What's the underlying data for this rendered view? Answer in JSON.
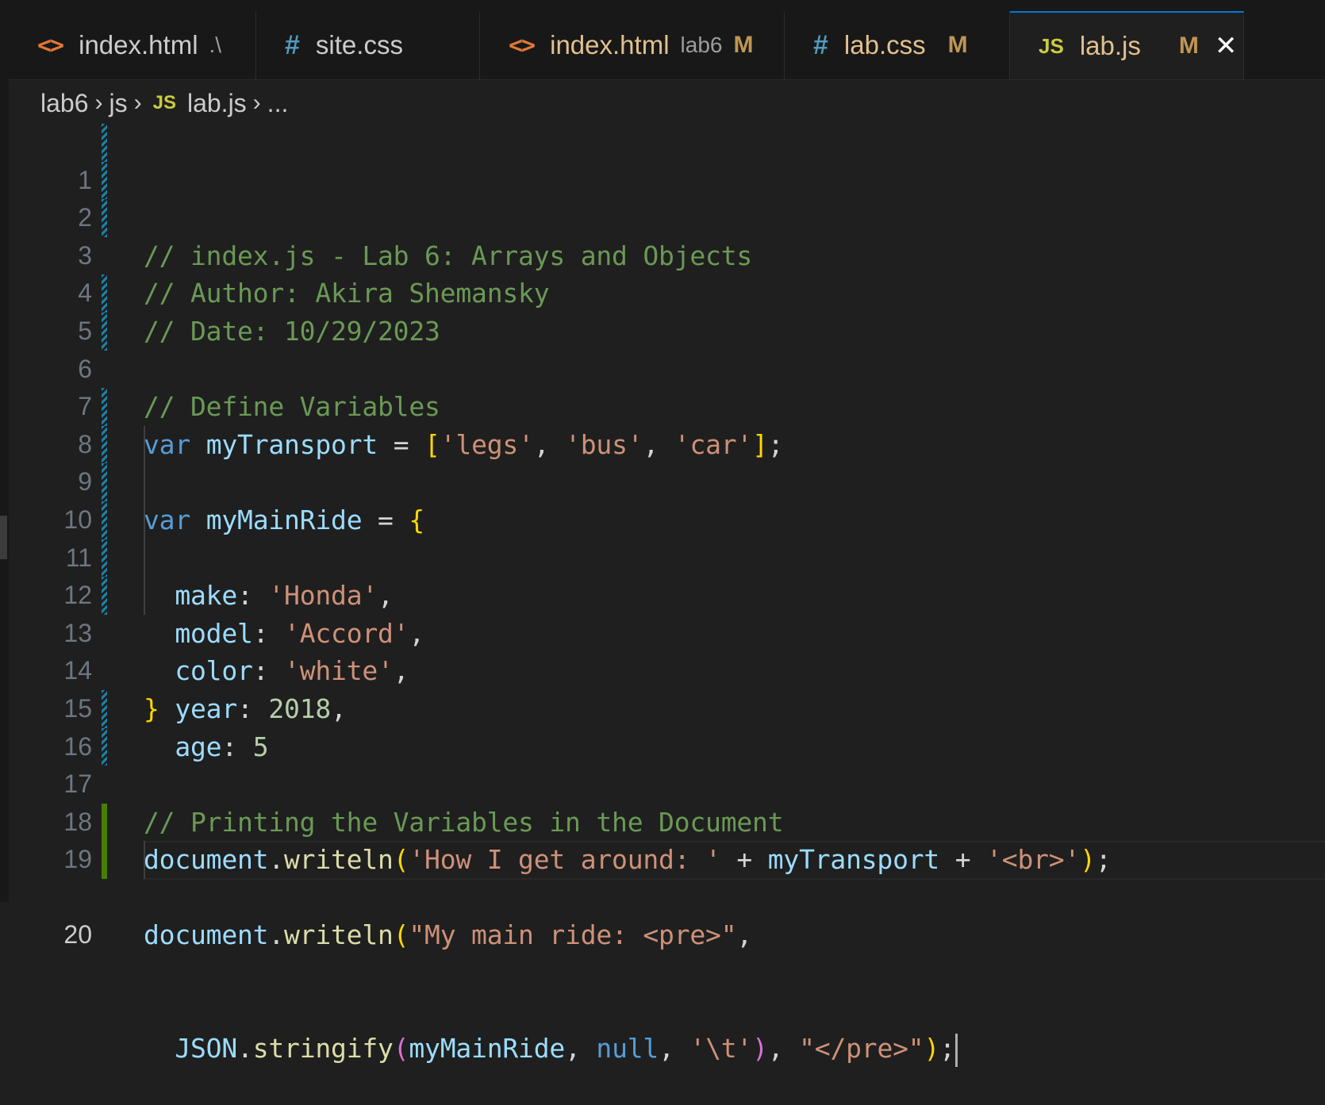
{
  "tabs": [
    {
      "icon": "<>",
      "label": "index.html",
      "desc": ".\\",
      "mod": ""
    },
    {
      "icon": "#",
      "label": "site.css",
      "desc": "",
      "mod": ""
    },
    {
      "icon": "<>",
      "label": "index.html",
      "desc": "lab6",
      "mod": "M"
    },
    {
      "icon": "#",
      "label": "lab.css",
      "desc": "",
      "mod": "M"
    },
    {
      "icon": "JS",
      "label": "lab.js",
      "desc": "",
      "mod": "M",
      "close": "✕"
    }
  ],
  "breadcrumb": {
    "folder": "lab6",
    "subfolder": "js",
    "file_icon": "JS",
    "file": "lab.js",
    "more": "..."
  },
  "line_numbers": [
    "1",
    "2",
    "3",
    "4",
    "5",
    "6",
    "7",
    "8",
    "9",
    "10",
    "11",
    "12",
    "13",
    "14",
    "15",
    "16",
    "17",
    "18",
    "19",
    "20"
  ],
  "code": {
    "l1": "// index.js - Lab 6: Arrays and Objects",
    "l2": "// Author: Akira Shemansky",
    "l3": "// Date: 10/29/2023",
    "l5": "// Define Variables",
    "l6": {
      "kw": "var",
      "name": "myTransport",
      "eq": " = ",
      "open": "[",
      "s1": "'legs'",
      "c": ", ",
      "s2": "'bus'",
      "s3": "'car'",
      "close": "]",
      "end": ";"
    },
    "l8": {
      "kw": "var",
      "name": "myMainRide",
      "eq": " = ",
      "open": "{"
    },
    "l9": {
      "key": "make",
      "colon": ": ",
      "val": "'Honda'",
      "end": ","
    },
    "l10": {
      "key": "model",
      "colon": ": ",
      "val": "'Accord'",
      "end": ","
    },
    "l11": {
      "key": "color",
      "colon": ": ",
      "val": "'white'",
      "end": ","
    },
    "l12": {
      "key": "year",
      "colon": ": ",
      "val": "2018",
      "end": ","
    },
    "l13": {
      "key": "age",
      "colon": ": ",
      "val": "5"
    },
    "l14": "}",
    "l16": "// Printing the Variables in the Document",
    "l17": {
      "obj": "document",
      "dot": ".",
      "fn": "writeln",
      "open": "(",
      "s1": "'How I get around: '",
      "plus": " + ",
      "v": "myTransport",
      "s2": "'<br>'",
      "close": ")",
      "end": ";"
    },
    "l19": {
      "obj": "document",
      "dot": ".",
      "fn": "writeln",
      "open": "(",
      "s1": "\"My main ride: <pre>\"",
      "c": ","
    },
    "l20": {
      "obj": "JSON",
      "dot": ".",
      "fn": "stringify",
      "open": "(",
      "v": "myMainRide",
      "c": ", ",
      "null": "null",
      "s1": "'\\t'",
      "close": ")",
      "s2": "\"</pre>\"",
      "close2": ")",
      "end": ";"
    }
  }
}
